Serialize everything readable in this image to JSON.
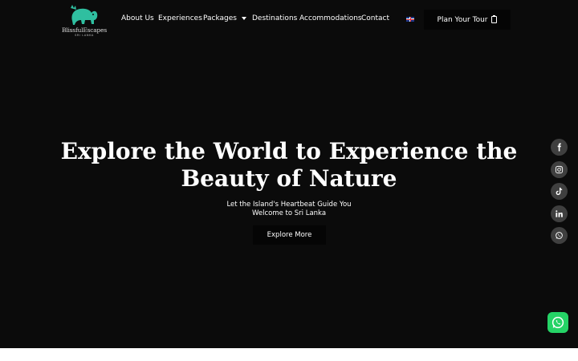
{
  "brand": {
    "logo_text": "BlissfulEscapes",
    "logo_sub": "SRI LANKA",
    "logo_accent": "#2fbfa0"
  },
  "nav": {
    "items": [
      {
        "label": "About Us"
      },
      {
        "label": "Experiences"
      },
      {
        "label": "Packages",
        "has_dropdown": true
      },
      {
        "label": "Destinations"
      },
      {
        "label": "Accommodations"
      },
      {
        "label": "Contact"
      }
    ],
    "language_flag": "uk-flag-icon",
    "cta_label": "Plan Your Tour",
    "cta_icon": "clipboard-icon"
  },
  "hero": {
    "title_line1": "Explore the World to Experience the",
    "title_line2": "Beauty of Nature",
    "subtitle_line1": "Let the Island's Heartbeat Guide You",
    "subtitle_line2": "Welcome to Sri Lanka",
    "button_label": "Explore More"
  },
  "social": {
    "icons": [
      "facebook-icon",
      "instagram-icon",
      "tiktok-icon",
      "linkedin-icon",
      "whatsapp-icon"
    ],
    "background": "#3f3f3f"
  },
  "whatsapp_float": {
    "icon": "whatsapp-icon",
    "color": "#25d366"
  }
}
